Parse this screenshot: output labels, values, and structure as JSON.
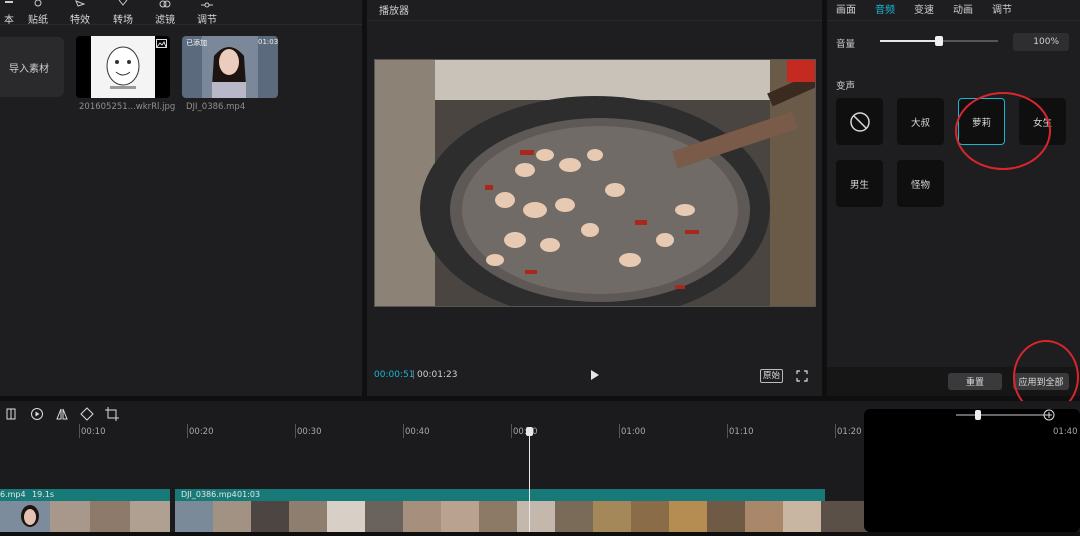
{
  "toolbar": {
    "items": [
      {
        "label": "本",
        "icon": "text-icon"
      },
      {
        "label": "贴纸",
        "icon": "sticker-icon"
      },
      {
        "label": "特效",
        "icon": "effects-icon"
      },
      {
        "label": "转场",
        "icon": "transition-icon"
      },
      {
        "label": "滤镜",
        "icon": "filter-icon"
      },
      {
        "label": "调节",
        "icon": "adjust-icon"
      }
    ]
  },
  "media": {
    "import_label": "导入素材",
    "items": [
      {
        "name": "201605251...wkrRl.jpg",
        "type": "image"
      },
      {
        "name": "DJI_0386.mp4",
        "badge": "已添加",
        "duration": "01:03",
        "type": "video"
      }
    ]
  },
  "player": {
    "title": "播放器",
    "current_time": "00:00:51",
    "total_time": "00:01:23",
    "original_label": "原始"
  },
  "inspector": {
    "tabs": [
      {
        "label": "画面",
        "active": false
      },
      {
        "label": "音频",
        "active": true
      },
      {
        "label": "变速",
        "active": false
      },
      {
        "label": "动画",
        "active": false
      },
      {
        "label": "调节",
        "active": false
      }
    ],
    "volume_label": "音量",
    "volume_value": "100%",
    "volume_level": 0.5,
    "voice_change_label": "变声",
    "voices": [
      {
        "label": "none",
        "icon": "none-icon",
        "selected": false
      },
      {
        "label": "大叔",
        "selected": false
      },
      {
        "label": "萝莉",
        "selected": true
      },
      {
        "label": "女生",
        "selected": false
      },
      {
        "label": "男生",
        "selected": false
      },
      {
        "label": "怪物",
        "selected": false
      }
    ],
    "reset_label": "重置",
    "apply_all_label": "应用到全部"
  },
  "timeline": {
    "ticks": [
      "00:10",
      "00:20",
      "00:30",
      "00:40",
      "00:50",
      "01:00",
      "01:10",
      "01:20",
      "01:40"
    ],
    "track1": {
      "name": "6.mp4",
      "duration": "19.1s"
    },
    "track2": {
      "name": "DJI_0386.mp4",
      "duration": "01:03"
    }
  },
  "colors": {
    "accent": "#19b6d4",
    "annotation": "#d8262c",
    "track": "#187a78"
  }
}
